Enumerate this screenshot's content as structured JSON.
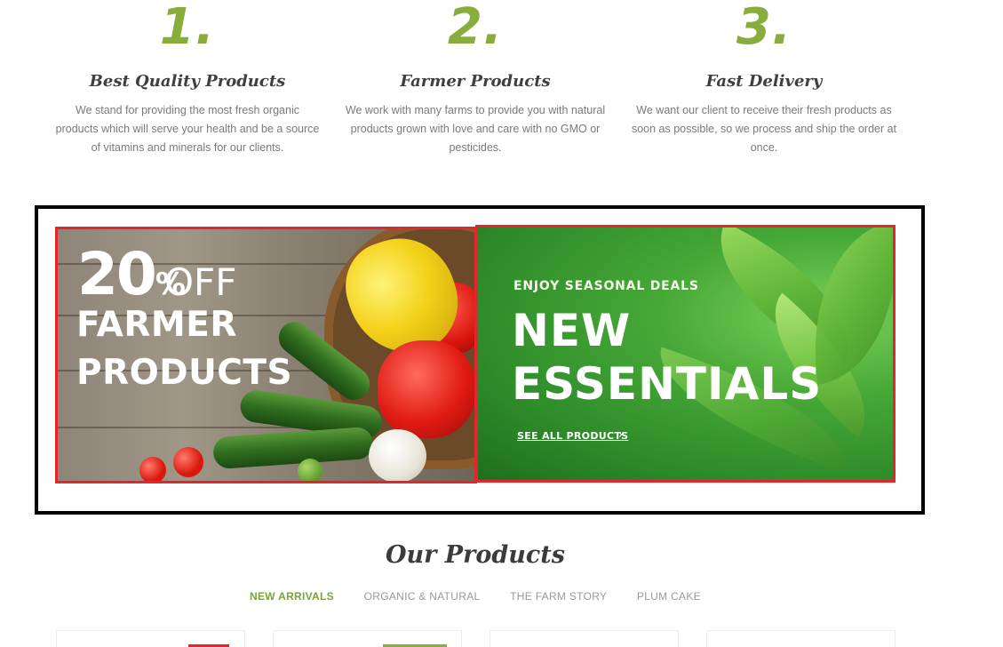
{
  "features": [
    {
      "number": "1.",
      "title": "Best Quality Products",
      "text": "We stand for providing the most fresh organic products which will serve your health and be a source of vitamins and minerals for our clients."
    },
    {
      "number": "2.",
      "title": "Farmer Products",
      "text": "We work with many farms to provide you with natural products grown with love and care with no GMO or pesticides."
    },
    {
      "number": "3.",
      "title": "Fast Delivery",
      "text": "We want our client to receive their fresh products as soon as possible, so we process and ship the order at once."
    }
  ],
  "banners": {
    "promo": {
      "percent": "20",
      "percent_symbol": "%",
      "off": "OFF",
      "line1": "FARMER",
      "line2": "PRODUCTS"
    },
    "deals": {
      "kicker": "ENJOY SEASONAL DEALS",
      "line1": "NEW",
      "line2": "ESSENTIALS",
      "link": "SEE ALL PRODUCTS",
      "chevron": "›"
    }
  },
  "products": {
    "title": "Our Products",
    "tabs": [
      "NEW ARRIVALS",
      "ORGANIC & NATURAL",
      "THE FARM STORY",
      "PLUM CAKE"
    ],
    "active_tab": "NEW ARRIVALS"
  },
  "colors": {
    "accent_green": "#88ad3c",
    "highlight_red": "#e3262d",
    "frame_black": "#000000",
    "badge_red": "#e3262d",
    "badge_green": "#88ad3c"
  }
}
